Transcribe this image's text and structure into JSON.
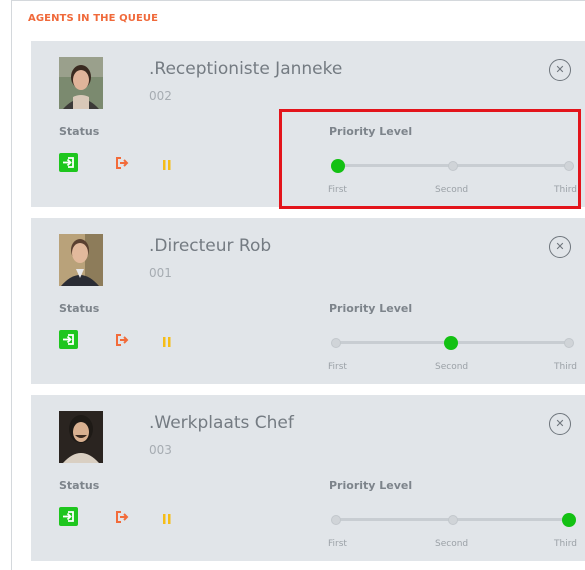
{
  "header": {
    "title": "AGENTS IN THE QUEUE"
  },
  "labels": {
    "status": "Status",
    "priority": "Priority Level",
    "levels": [
      "First",
      "Second",
      "Third"
    ]
  },
  "agents": [
    {
      "name": ".Receptioniste Janneke",
      "ext": "002",
      "priority_index": 0
    },
    {
      "name": ".Directeur Rob",
      "ext": "001",
      "priority_index": 1
    },
    {
      "name": ".Werkplaats Chef",
      "ext": "003",
      "priority_index": 2
    }
  ],
  "icons": {
    "close": "close-circle-icon",
    "login": "login-icon",
    "logout": "logout-icon",
    "pause": "pause-icon"
  },
  "colors": {
    "header": "#f0693a",
    "active_priority": "#13c113",
    "login_button": "#1ec61e",
    "logout_icon": "#f26b3a",
    "pause_icon": "#f5bd18",
    "card_background": "#e1e5e9",
    "highlight": "#e3141b"
  }
}
